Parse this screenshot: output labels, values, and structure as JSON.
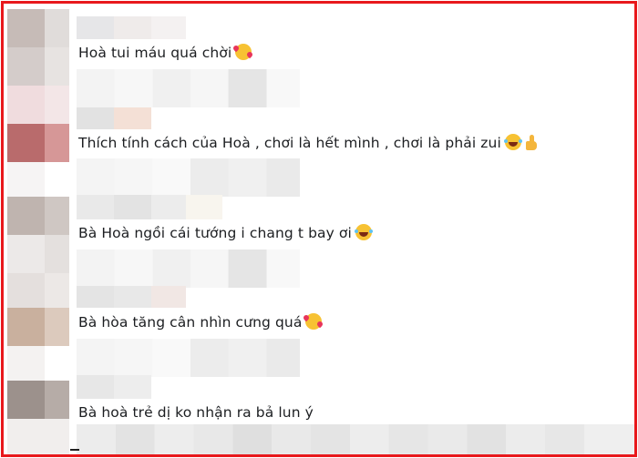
{
  "comments": [
    {
      "text": "Hoà tui máu quá chời",
      "emoji": "smiling-face-with-hearts"
    },
    {
      "text": "Thích tính cách của Hoà , chơi là hết mình , chơi là phải zui",
      "emoji": "face-with-tears-of-joy",
      "emoji2": "thumbs-up"
    },
    {
      "text": "Bà Hoà ngồi cái tướng i chang t bay ơi",
      "emoji": "face-with-tears-of-joy"
    },
    {
      "text": "Bà hòa tăng cân nhìn cưng quá",
      "emoji": "smiling-face-with-hearts"
    },
    {
      "text": "Bà hoà trẻ dị ko nhận ra bả lun ý",
      "emoji": ""
    }
  ],
  "colors": {
    "frame_border": "#e8181c",
    "text": "#1c1e21",
    "background": "#ffffff"
  }
}
